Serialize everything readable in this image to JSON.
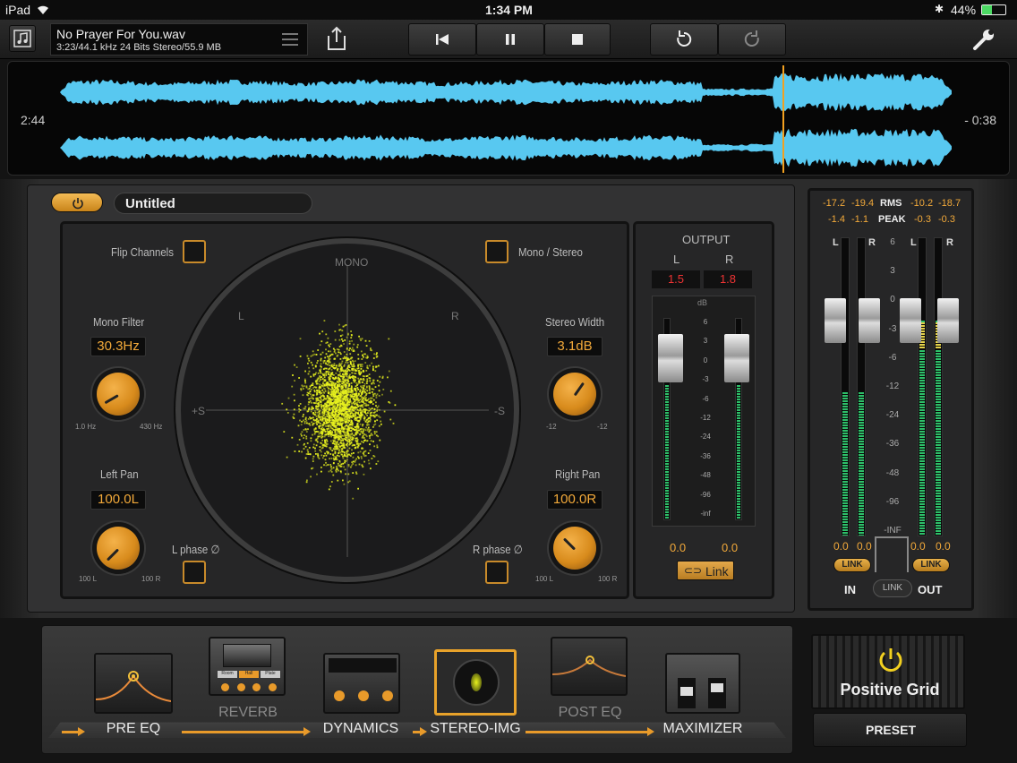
{
  "status": {
    "device": "iPad",
    "time": "1:34 PM",
    "battery": "44%"
  },
  "file": {
    "name": "No Prayer For You.wav",
    "info": "3:23/44.1 kHz 24 Bits Stereo/55.9 MB"
  },
  "transport": {
    "elapsed": "2:44",
    "remaining": "- 0:38",
    "playhead_fraction": 0.81
  },
  "preset": {
    "name": "Untitled"
  },
  "stereo": {
    "flip_channels": "Flip Channels",
    "mono_stereo": "Mono / Stereo",
    "mono_filter_label": "Mono Filter",
    "mono_filter_value": "30.3Hz",
    "mono_filter_min": "1.0 Hz",
    "mono_filter_max": "430 Hz",
    "stereo_width_label": "Stereo Width",
    "stereo_width_value": "3.1dB",
    "stereo_width_min": "-12",
    "stereo_width_max": "-12",
    "left_pan_label": "Left Pan",
    "left_pan_value": "100.0L",
    "right_pan_label": "Right Pan",
    "right_pan_value": "100.0R",
    "pan_min": "100 L",
    "pan_max": "100 R",
    "l_phase": "L phase ∅",
    "r_phase": "R phase ∅",
    "scope": {
      "mono": "MONO",
      "l": "L",
      "r": "R",
      "minus_s": "-S",
      "plus_s": "+S"
    }
  },
  "output": {
    "title": "OUTPUT",
    "l": "L",
    "r": "R",
    "l_peak": "1.5",
    "r_peak": "1.8",
    "db": "dB",
    "scale": [
      "6",
      "3",
      "0",
      "-3",
      "-6",
      "-12",
      "-24",
      "-36",
      "-48",
      "-96",
      "-inf"
    ],
    "l_value": "0.0",
    "r_value": "0.0",
    "link": "Link"
  },
  "master": {
    "rms_label": "RMS",
    "peak_label": "PEAK",
    "in_rms_l": "-17.2",
    "in_rms_r": "-19.4",
    "out_rms_l": "-10.2",
    "out_rms_r": "-18.7",
    "in_peak_l": "-1.4",
    "in_peak_r": "-1.1",
    "out_peak_l": "-0.3",
    "out_peak_r": "-0.3",
    "l": "L",
    "r": "R",
    "scale": [
      "6",
      "3",
      "0",
      "-3",
      "-6",
      "-12",
      "-24",
      "-36",
      "-48",
      "-96",
      "-INF"
    ],
    "in_l_val": "0.0",
    "in_r_val": "0.0",
    "out_l_val": "0.0",
    "out_r_val": "0.0",
    "link": "LINK",
    "in": "IN",
    "out": "OUT"
  },
  "chain": {
    "pre_eq": "PRE EQ",
    "reverb": "REVERB",
    "dynamics": "DYNAMICS",
    "stereo_img": "STEREO-IMG",
    "post_eq": "POST EQ",
    "maximizer": "MAXIMIZER",
    "reverb_btns": [
      "Room",
      "Hall",
      "Plate"
    ]
  },
  "brand": {
    "name": "Positive Grid",
    "preset": "PRESET"
  },
  "colors": {
    "accent": "#e89a2a",
    "wave": "#58c8f0",
    "scatter": "#e8f21e",
    "meter": "#2ec06a"
  }
}
